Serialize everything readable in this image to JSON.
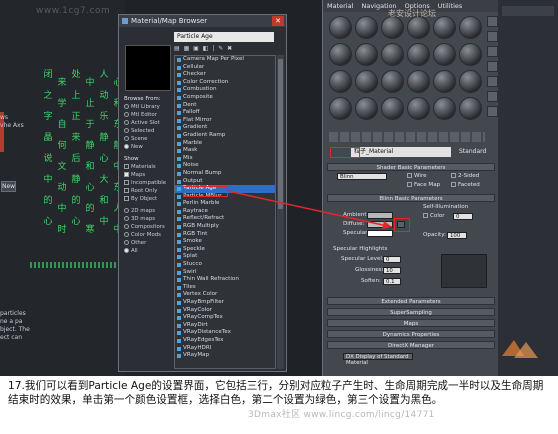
{
  "viewport": {
    "watermark": "www.1cg7.com",
    "columns": [
      [
        "闭",
        "之",
        "字",
        "晶",
        "说",
        "中",
        "的",
        "心"
      ],
      [
        "来",
        "学",
        "自",
        "何",
        "文",
        "动",
        "中",
        "时"
      ],
      [
        "处",
        "上",
        "正",
        "来",
        "后",
        "静",
        "的",
        "心"
      ],
      [
        "中",
        "止",
        "于",
        "静",
        "和",
        "心",
        "的",
        "寒"
      ],
      [
        "人",
        "动",
        "乐",
        "静",
        "心",
        "大",
        "和",
        "中"
      ],
      [
        "心",
        "和",
        "东",
        "静",
        "中",
        "东",
        "人",
        "中"
      ]
    ],
    "side_labels": [
      "ws",
      "vhe Axs"
    ],
    "new_button": "New",
    "bottom_text": [
      "particles",
      "ne a pa",
      "bject. The",
      "ect can"
    ]
  },
  "browser": {
    "title": "Material/Map Browser",
    "search": "Particle Age",
    "browse_from_header": "Browse From:",
    "browse_from": [
      {
        "label": "Mtl Library",
        "on": false
      },
      {
        "label": "Mtl Editor",
        "on": false
      },
      {
        "label": "Active Slot",
        "on": false
      },
      {
        "label": "Selected",
        "on": false
      },
      {
        "label": "Scene",
        "on": false
      },
      {
        "label": "New",
        "on": true
      }
    ],
    "show_header": "Show",
    "show": [
      {
        "label": "Materials",
        "on": false
      },
      {
        "label": "Maps",
        "on": true
      },
      {
        "label": "Incompatible",
        "on": false
      },
      {
        "label": "Root Only",
        "on": false
      },
      {
        "label": "By Object",
        "on": false
      }
    ],
    "categories": [
      {
        "label": "2D maps",
        "on": false
      },
      {
        "label": "3D maps",
        "on": false
      },
      {
        "label": "Compositors",
        "on": false
      },
      {
        "label": "Color Mods",
        "on": false
      },
      {
        "label": "Other",
        "on": false
      },
      {
        "label": "All",
        "on": true
      }
    ],
    "map_list": [
      "Camera Map Per Pixel",
      "Cellular",
      "Checker",
      "Color Correction",
      "Combustion",
      "Composite",
      "Dent",
      "Falloff",
      "Flat Mirror",
      "Gradient",
      "Gradient Ramp",
      "Marble",
      "Mask",
      "Mix",
      "Noise",
      "Normal Bump",
      "Output",
      "Particle Age",
      "Particle MBlur",
      "Perlin Marble",
      "Raytrace",
      "Reflect/Refract",
      "RGB Multiply",
      "RGB Tint",
      "Smoke",
      "Speckle",
      "Splat",
      "Stucco",
      "Swirl",
      "Thin Wall Refraction",
      "Tiles",
      "Vertex Color",
      "VRayBmpFilter",
      "VRayColor",
      "VRayCompTex",
      "VRayDirt",
      "VRayDistanceTex",
      "VRayEdgesTex",
      "VRayHDRI",
      "VRayMap"
    ],
    "selected_index": 17
  },
  "editor": {
    "menu": [
      "Material",
      "Navigation",
      "Options",
      "Utilities"
    ],
    "material_name": "粒子_Material",
    "material_type": "Standard",
    "shader_rollout": "Shader Basic Parameters",
    "shader": "Blinn",
    "shader_options": [
      "Wire",
      "2-Sided",
      "Face Map",
      "Faceted"
    ],
    "blinn_rollout": "Blinn Basic Parameters",
    "self_illum": "Self-Illumination",
    "color_label": "Color",
    "color_value": "0",
    "ambient": "Ambient:",
    "diffuse": "Diffuse:",
    "specular": "Specular:",
    "opacity_label": "Opacity:",
    "opacity_value": "100",
    "spec_highlights": "Specular Highlights",
    "spec_level_label": "Specular Level:",
    "spec_level": "0",
    "glossiness_label": "Glossiness:",
    "glossiness": "10",
    "soften_label": "Soften:",
    "soften": "0.1",
    "rollouts": [
      "Extended Parameters",
      "SuperSampling",
      "Maps",
      "Dynamics Properties",
      "DirectX Manager"
    ],
    "dx_option": "DX Display of Standard Material",
    "colors": {
      "ambient": "#b7b7b7",
      "diffuse": "#bcbcbc"
    }
  },
  "overlay_watermark": "老安设计论坛",
  "caption": "17.我们可以看到Particle Age的设置界面，它包括三行，分别对应粒子产生时、生命周期完成一半时以及生命周期结束时的效果，单击第一个颜色设置框，选择白色，第二个设置为绿色，第三个设置为黑色。",
  "bottom_watermark": "3Dmax社区 www.lincg.com/lincg/14771"
}
